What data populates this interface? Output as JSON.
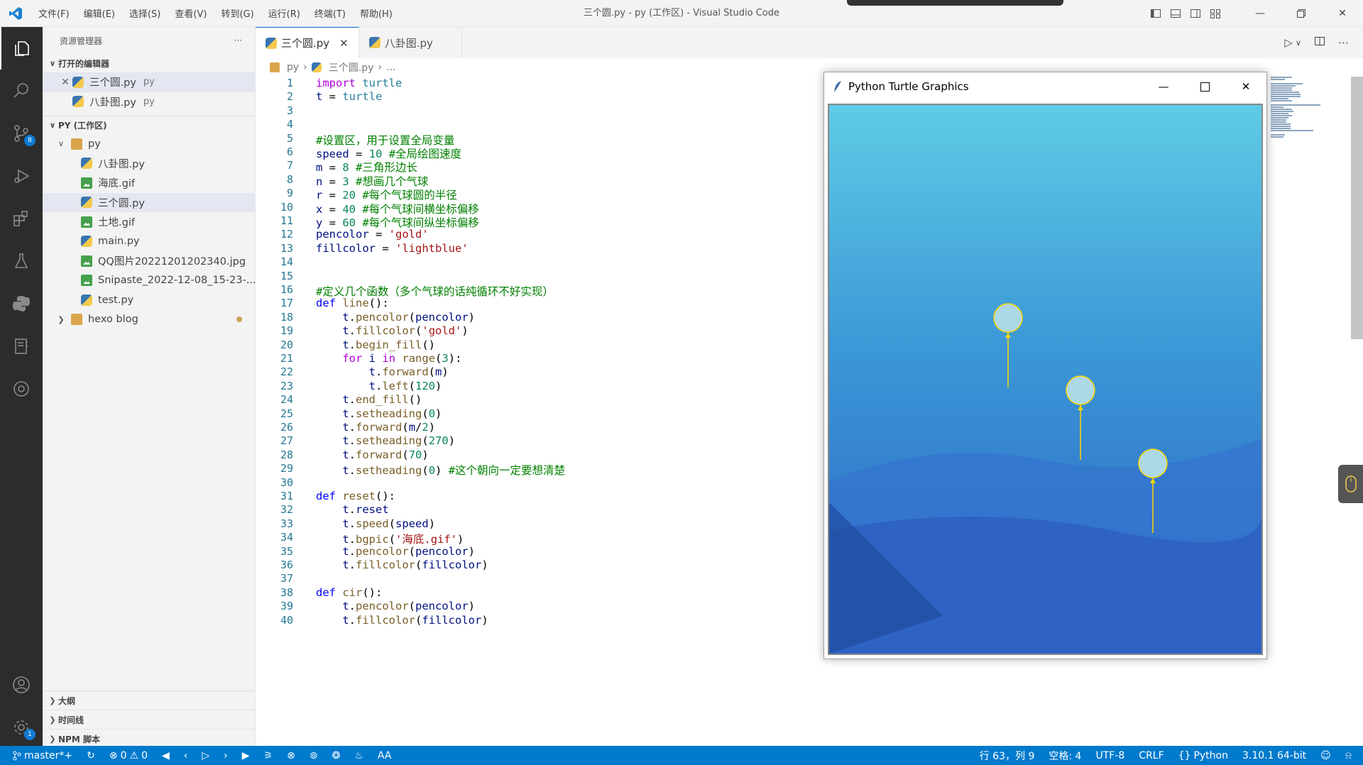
{
  "window": {
    "title": "三个圆.py - py (工作区) - Visual Studio Code"
  },
  "menu": [
    "文件(F)",
    "编辑(E)",
    "选择(S)",
    "查看(V)",
    "转到(G)",
    "运行(R)",
    "终端(T)",
    "帮助(H)"
  ],
  "activity": {
    "scm_badge": "8",
    "settings_badge": "1",
    "items": [
      "files-icon",
      "search-icon",
      "source-control-icon",
      "run-debug-icon",
      "extensions-icon",
      "testing-icon",
      "python-icon",
      "notebook-icon",
      "remote-icon"
    ]
  },
  "sidebar": {
    "title": "资源管理器",
    "more": "···",
    "open_editors_label": "打开的编辑器",
    "open_editors": [
      {
        "name": "三个圆.py",
        "desc": "py",
        "selected": true,
        "icon": "python-file-icon"
      },
      {
        "name": "八卦图.py",
        "desc": "py",
        "selected": false,
        "icon": "python-file-icon"
      }
    ],
    "workspace_label": "PY (工作区)",
    "folder_py": "py",
    "files": [
      {
        "name": "八卦图.py",
        "type": "py"
      },
      {
        "name": "海底.gif",
        "type": "img"
      },
      {
        "name": "三个圆.py",
        "type": "py",
        "selected": true
      },
      {
        "name": "土地.gif",
        "type": "img"
      },
      {
        "name": "main.py",
        "type": "py"
      },
      {
        "name": "QQ图片20221201202340.jpg",
        "type": "img"
      },
      {
        "name": "Snipaste_2022-12-08_15-23-...",
        "type": "img"
      },
      {
        "name": "test.py",
        "type": "py"
      }
    ],
    "folder_hexo": "hexo blog",
    "bottom_sections": [
      "大纲",
      "时间线",
      "NPM 脚本"
    ]
  },
  "tabs": [
    {
      "label": "三个圆.py",
      "active": true,
      "close": "✕"
    },
    {
      "label": "八卦图.py",
      "active": false
    }
  ],
  "breadcrumb": [
    "py",
    "三个圆.py",
    "..."
  ],
  "code_lines": [
    "1",
    "2",
    "3",
    "4",
    "5",
    "6",
    "7",
    "8",
    "9",
    "10",
    "11",
    "12",
    "13",
    "14",
    "15",
    "16",
    "17",
    "18",
    "19",
    "20",
    "21",
    "22",
    "23",
    "24",
    "25",
    "26",
    "27",
    "28",
    "29",
    "30",
    "31",
    "32",
    "33",
    "34",
    "35",
    "36",
    "37",
    "38",
    "39",
    "40"
  ],
  "turtle": {
    "title": "Python Turtle Graphics",
    "balloon_color": "#add8e6",
    "line_color": "#ffd700"
  },
  "status": {
    "branch": "master*+",
    "errors": "0",
    "warnings": "0",
    "position": "行 63，列 9",
    "spaces": "空格: 4",
    "encoding": "UTF-8",
    "eol": "CRLF",
    "language": "Python",
    "interpreter": "3.10.1 64-bit",
    "aa": "AA"
  }
}
